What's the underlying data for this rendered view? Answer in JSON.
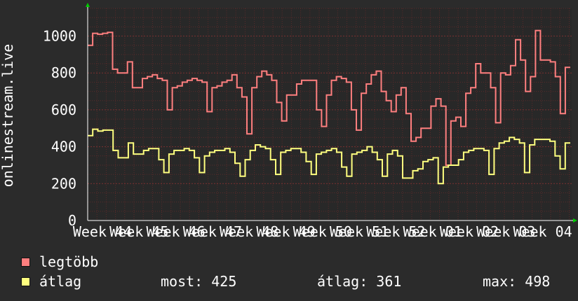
{
  "chart_data": {
    "type": "line",
    "ylabel": "onlinestream.live",
    "ylim": [
      0,
      1150
    ],
    "yticks": [
      0,
      200,
      400,
      600,
      800,
      1000
    ],
    "x_tick_labels": [
      "Week 44",
      "Week 45",
      "Week 46",
      "Week 47",
      "Week 48",
      "Week 49",
      "Week 50",
      "Week 51",
      "Week 52",
      "Week 01",
      "Week 02",
      "Week 03",
      "Week 04"
    ],
    "grid": true,
    "colors": {
      "background": "#2b2b2b",
      "plot_background": "#282828",
      "grid": "#5a2a2a",
      "axis_arrow": "#00cc00"
    },
    "series": [
      {
        "name": "legtöbb",
        "color": "#ff7f7f",
        "values": [
          950,
          1015,
          1010,
          1015,
          1020,
          820,
          800,
          800,
          860,
          720,
          720,
          770,
          780,
          790,
          770,
          760,
          600,
          720,
          730,
          750,
          760,
          770,
          760,
          750,
          590,
          720,
          730,
          750,
          760,
          790,
          720,
          670,
          470,
          720,
          780,
          810,
          790,
          760,
          640,
          540,
          680,
          680,
          740,
          760,
          760,
          760,
          600,
          510,
          680,
          760,
          780,
          770,
          750,
          600,
          490,
          690,
          740,
          790,
          810,
          700,
          650,
          590,
          680,
          720,
          580,
          430,
          450,
          500,
          500,
          620,
          660,
          620,
          300,
          540,
          560,
          510,
          690,
          720,
          850,
          800,
          800,
          720,
          530,
          800,
          790,
          840,
          980,
          870,
          700,
          780,
          1030,
          870,
          870,
          860,
          780,
          580,
          830
        ]
      },
      {
        "name": "átlag",
        "color": "#ffff7f",
        "values": [
          460,
          495,
          485,
          490,
          490,
          380,
          340,
          340,
          420,
          360,
          360,
          380,
          390,
          390,
          330,
          260,
          360,
          380,
          380,
          390,
          380,
          340,
          260,
          350,
          370,
          380,
          380,
          390,
          370,
          310,
          240,
          330,
          380,
          410,
          400,
          390,
          330,
          250,
          370,
          380,
          390,
          390,
          370,
          320,
          250,
          360,
          370,
          380,
          390,
          370,
          290,
          240,
          360,
          370,
          380,
          400,
          370,
          330,
          240,
          360,
          380,
          350,
          230,
          230,
          270,
          280,
          320,
          330,
          340,
          200,
          290,
          300,
          300,
          330,
          370,
          380,
          390,
          390,
          380,
          250,
          390,
          420,
          430,
          450,
          440,
          420,
          260,
          410,
          440,
          440,
          440,
          430,
          350,
          280,
          420
        ]
      }
    ]
  },
  "legend": {
    "max_label": "legtöbb",
    "avg_label": "átlag",
    "now_stat": "most: 425",
    "avg_stat": "átlag: 361",
    "max_stat": "max: 498"
  }
}
